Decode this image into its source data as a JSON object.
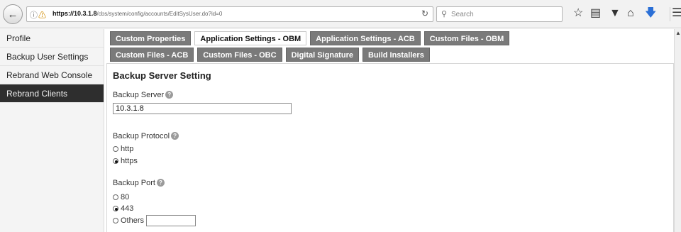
{
  "browser": {
    "url_host": "https://10.3.1.8",
    "url_path": "/cbs/system/config/accounts/EditSysUser.do?id=0",
    "search_placeholder": "Search",
    "icons": [
      "back-arrow-icon",
      "info-icon",
      "lock-warning-icon",
      "reload-icon",
      "search-icon",
      "star-icon",
      "reading-list-icon",
      "pocket-icon",
      "home-icon",
      "download-icon",
      "menu-icon"
    ]
  },
  "sidebar": {
    "items": [
      {
        "label": "Profile"
      },
      {
        "label": "Backup User Settings"
      },
      {
        "label": "Rebrand Web Console"
      },
      {
        "label": "Rebrand Clients",
        "active": true
      }
    ]
  },
  "tabs": {
    "row1": [
      {
        "label": "Custom Properties"
      },
      {
        "label": "Application Settings - OBM",
        "active": true
      },
      {
        "label": "Application Settings - ACB"
      },
      {
        "label": "Custom Files - OBM"
      }
    ],
    "row2": [
      {
        "label": "Custom Files - ACB"
      },
      {
        "label": "Custom Files - OBC"
      },
      {
        "label": "Digital Signature"
      },
      {
        "label": "Build Installers"
      }
    ]
  },
  "form": {
    "section_title": "Backup Server Setting",
    "backup_server": {
      "label": "Backup Server",
      "value": "10.3.1.8"
    },
    "backup_protocol": {
      "label": "Backup Protocol",
      "options": [
        {
          "label": "http",
          "checked": false
        },
        {
          "label": "https",
          "checked": true
        }
      ]
    },
    "backup_port": {
      "label": "Backup Port",
      "options": [
        {
          "label": "80",
          "checked": false
        },
        {
          "label": "443",
          "checked": true
        },
        {
          "label": "Others",
          "checked": false
        }
      ],
      "others_value": ""
    },
    "help_glyph": "?"
  }
}
